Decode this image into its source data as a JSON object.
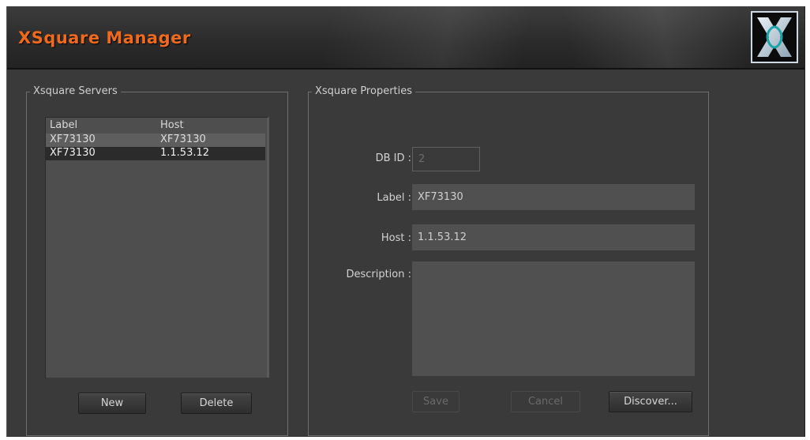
{
  "header": {
    "title": "XSquare Manager",
    "logo_icon": "xsquare-logo-icon"
  },
  "servers": {
    "legend": "Xsquare Servers",
    "columns": {
      "label": "Label",
      "host": "Host"
    },
    "rows": [
      {
        "label": "XF73130",
        "host": "XF73130"
      },
      {
        "label": "XF73130",
        "host": "1.1.53.12"
      }
    ],
    "new_label": "New",
    "delete_label": "Delete"
  },
  "properties": {
    "legend": "Xsquare Properties",
    "db_id_label": "DB ID :",
    "db_id_value": "2",
    "label_label": "Label :",
    "label_value": "XF73130",
    "host_label": "Host :",
    "host_value": "1.1.53.12",
    "description_label": "Description :",
    "description_value": "",
    "save_label": "Save",
    "cancel_label": "Cancel",
    "discover_label": "Discover..."
  },
  "colors": {
    "accent": "#f06a1e",
    "background": "#3a3a3a",
    "field": "#505050",
    "selected_row": "#2b2b2b"
  }
}
